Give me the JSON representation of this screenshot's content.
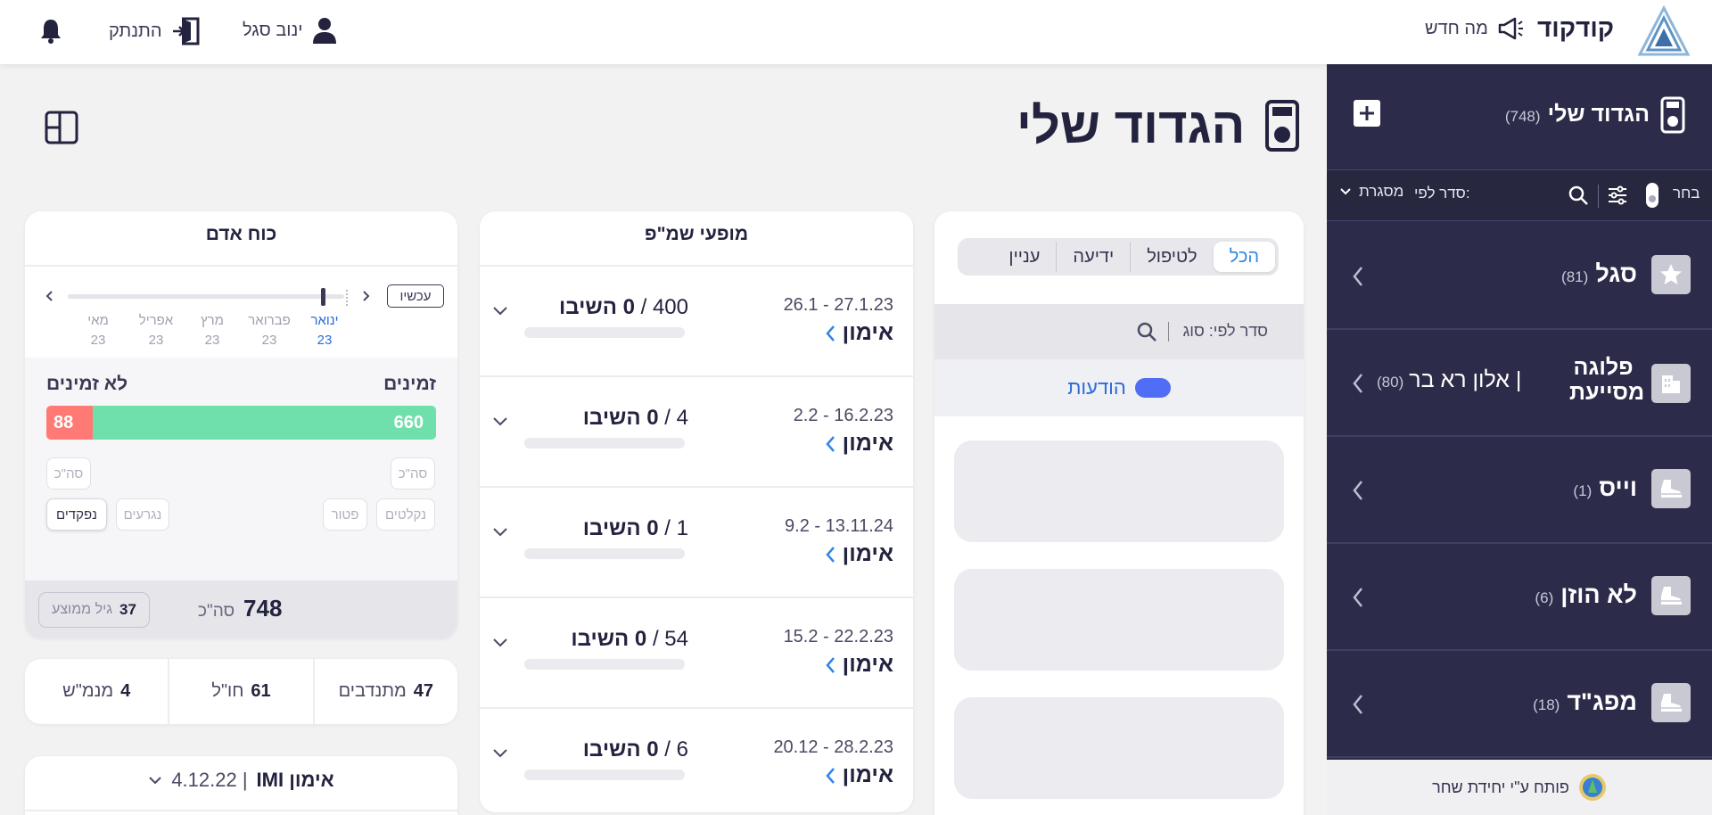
{
  "topbar": {
    "brand": "קודקוד",
    "whats_new": "מה חדש",
    "user_name": "ינוב סגל",
    "logout": "התנתק"
  },
  "page": {
    "title": "הגדוד שלי"
  },
  "sidebar": {
    "title": "הגדוד שלי",
    "count": "(748)",
    "choose": "בחר",
    "sort_label": "סדר לפי:",
    "sort_value": "מסגרת",
    "items": [
      {
        "title": "סגל",
        "count": "(81)",
        "icon": "star-icon"
      },
      {
        "title": "פלוגה מסייעת",
        "subtitle": "| אלון רא בר",
        "count": "(80)",
        "icon": "building-icon"
      },
      {
        "title": "וייס",
        "count": "(1)",
        "icon": "boot-icon"
      },
      {
        "title": "לא הוזן",
        "count": "(6)",
        "icon": "boot-icon"
      },
      {
        "title": "מפג\"ד",
        "count": "(18)",
        "icon": "boot-icon"
      }
    ],
    "footer": "פותח ע\"י יחידת שחר"
  },
  "messages_panel": {
    "tabs": [
      "הכל",
      "לטיפול",
      "ידיעה",
      "עניין"
    ],
    "active_tab": "הכל",
    "sort_label": "סדר לפי: סוג",
    "toggle_label": "הודעות"
  },
  "events_panel": {
    "title": "מופעי שמ\"פ",
    "events": [
      {
        "dates": "26.1 - 27.1.23",
        "type": "אימון",
        "total": "400",
        "returned": "0 השיבו"
      },
      {
        "dates": "2.2 - 16.2.23",
        "type": "אימון",
        "total": "4",
        "returned": "0 השיבו"
      },
      {
        "dates": "9.2 - 13.11.24",
        "type": "אימון",
        "total": "1",
        "returned": "0 השיבו"
      },
      {
        "dates": "15.2 - 22.2.23",
        "type": "אימון",
        "total": "54",
        "returned": "0 השיבו"
      },
      {
        "dates": "20.12 - 28.2.23",
        "type": "אימון",
        "total": "6",
        "returned": "0 השיבו"
      }
    ]
  },
  "manpower": {
    "title": "כוח אדם",
    "now_button": "עכשיו",
    "months": [
      {
        "name": "ינואר",
        "year": "23",
        "active": true
      },
      {
        "name": "פברואר",
        "year": "23"
      },
      {
        "name": "מרץ",
        "year": "23"
      },
      {
        "name": "אפריל",
        "year": "23"
      },
      {
        "name": "מאי",
        "year": "23"
      }
    ],
    "available_label": "זמינים",
    "unavailable_label": "לא זמינים",
    "available_value": 660,
    "unavailable_value": 88,
    "available_fraction": 0.88,
    "total_chip": "סה\"כ",
    "filters_right": [
      "נקלטים",
      "פטור"
    ],
    "filters_left": [
      "נגרעים",
      "נפקדים"
    ],
    "total_value": "748",
    "total_label": "סה\"כ",
    "avg_age_value": "37",
    "avg_age_label": "גיל ממוצע"
  },
  "stats": [
    {
      "value": "47",
      "label": "מתנדבים"
    },
    {
      "value": "61",
      "label": "חו\"ל"
    },
    {
      "value": "4",
      "label": "מנמ\"ש"
    }
  ],
  "training": {
    "title": "אימון IMI",
    "date": "| 4.12.22"
  },
  "colors": {
    "sidebar_bg": "#2c2c4a",
    "accent_blue": "#2f86e8",
    "available_green": "#6fe0ac",
    "unavailable_red": "#ff7a74",
    "toggle": "#4f6df5"
  }
}
